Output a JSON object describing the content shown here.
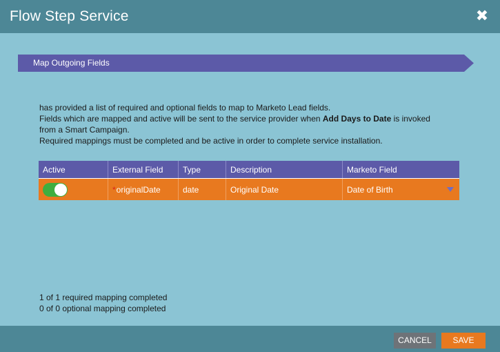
{
  "dialog": {
    "title": "Flow Step Service",
    "close_glyph": "✖"
  },
  "step": {
    "label": "Map Outgoing Fields"
  },
  "intro": {
    "line1": "has provided a list of required and optional fields to map to Marketo Lead fields.",
    "line2_before": "Fields which are mapped and active will be sent to the service provider when ",
    "line2_bold": "Add Days to Date",
    "line2_after": " is invoked",
    "line3": "from a Smart Campaign.",
    "line4": "Required mappings must be completed and be active in order to complete service installation."
  },
  "table": {
    "columns": [
      "Active",
      "External Field",
      "Type",
      "Description",
      "Marketo Field"
    ],
    "rows": [
      {
        "active": true,
        "required_marker": "*",
        "external_field": "originalDate",
        "type": "date",
        "description": "Original Date",
        "marketo_field": "Date of Birth"
      }
    ]
  },
  "counts": {
    "required": "1 of 1 required mapping completed",
    "optional": "0 of 0 optional mapping completed"
  },
  "footer": {
    "cancel_label": "CANCEL",
    "save_label": "SAVE"
  },
  "colors": {
    "header": "#4d8796",
    "background": "#8bc4d4",
    "banner": "#5c5aa8",
    "row": "#e8791f",
    "toggle_on": "#3fae3f"
  }
}
